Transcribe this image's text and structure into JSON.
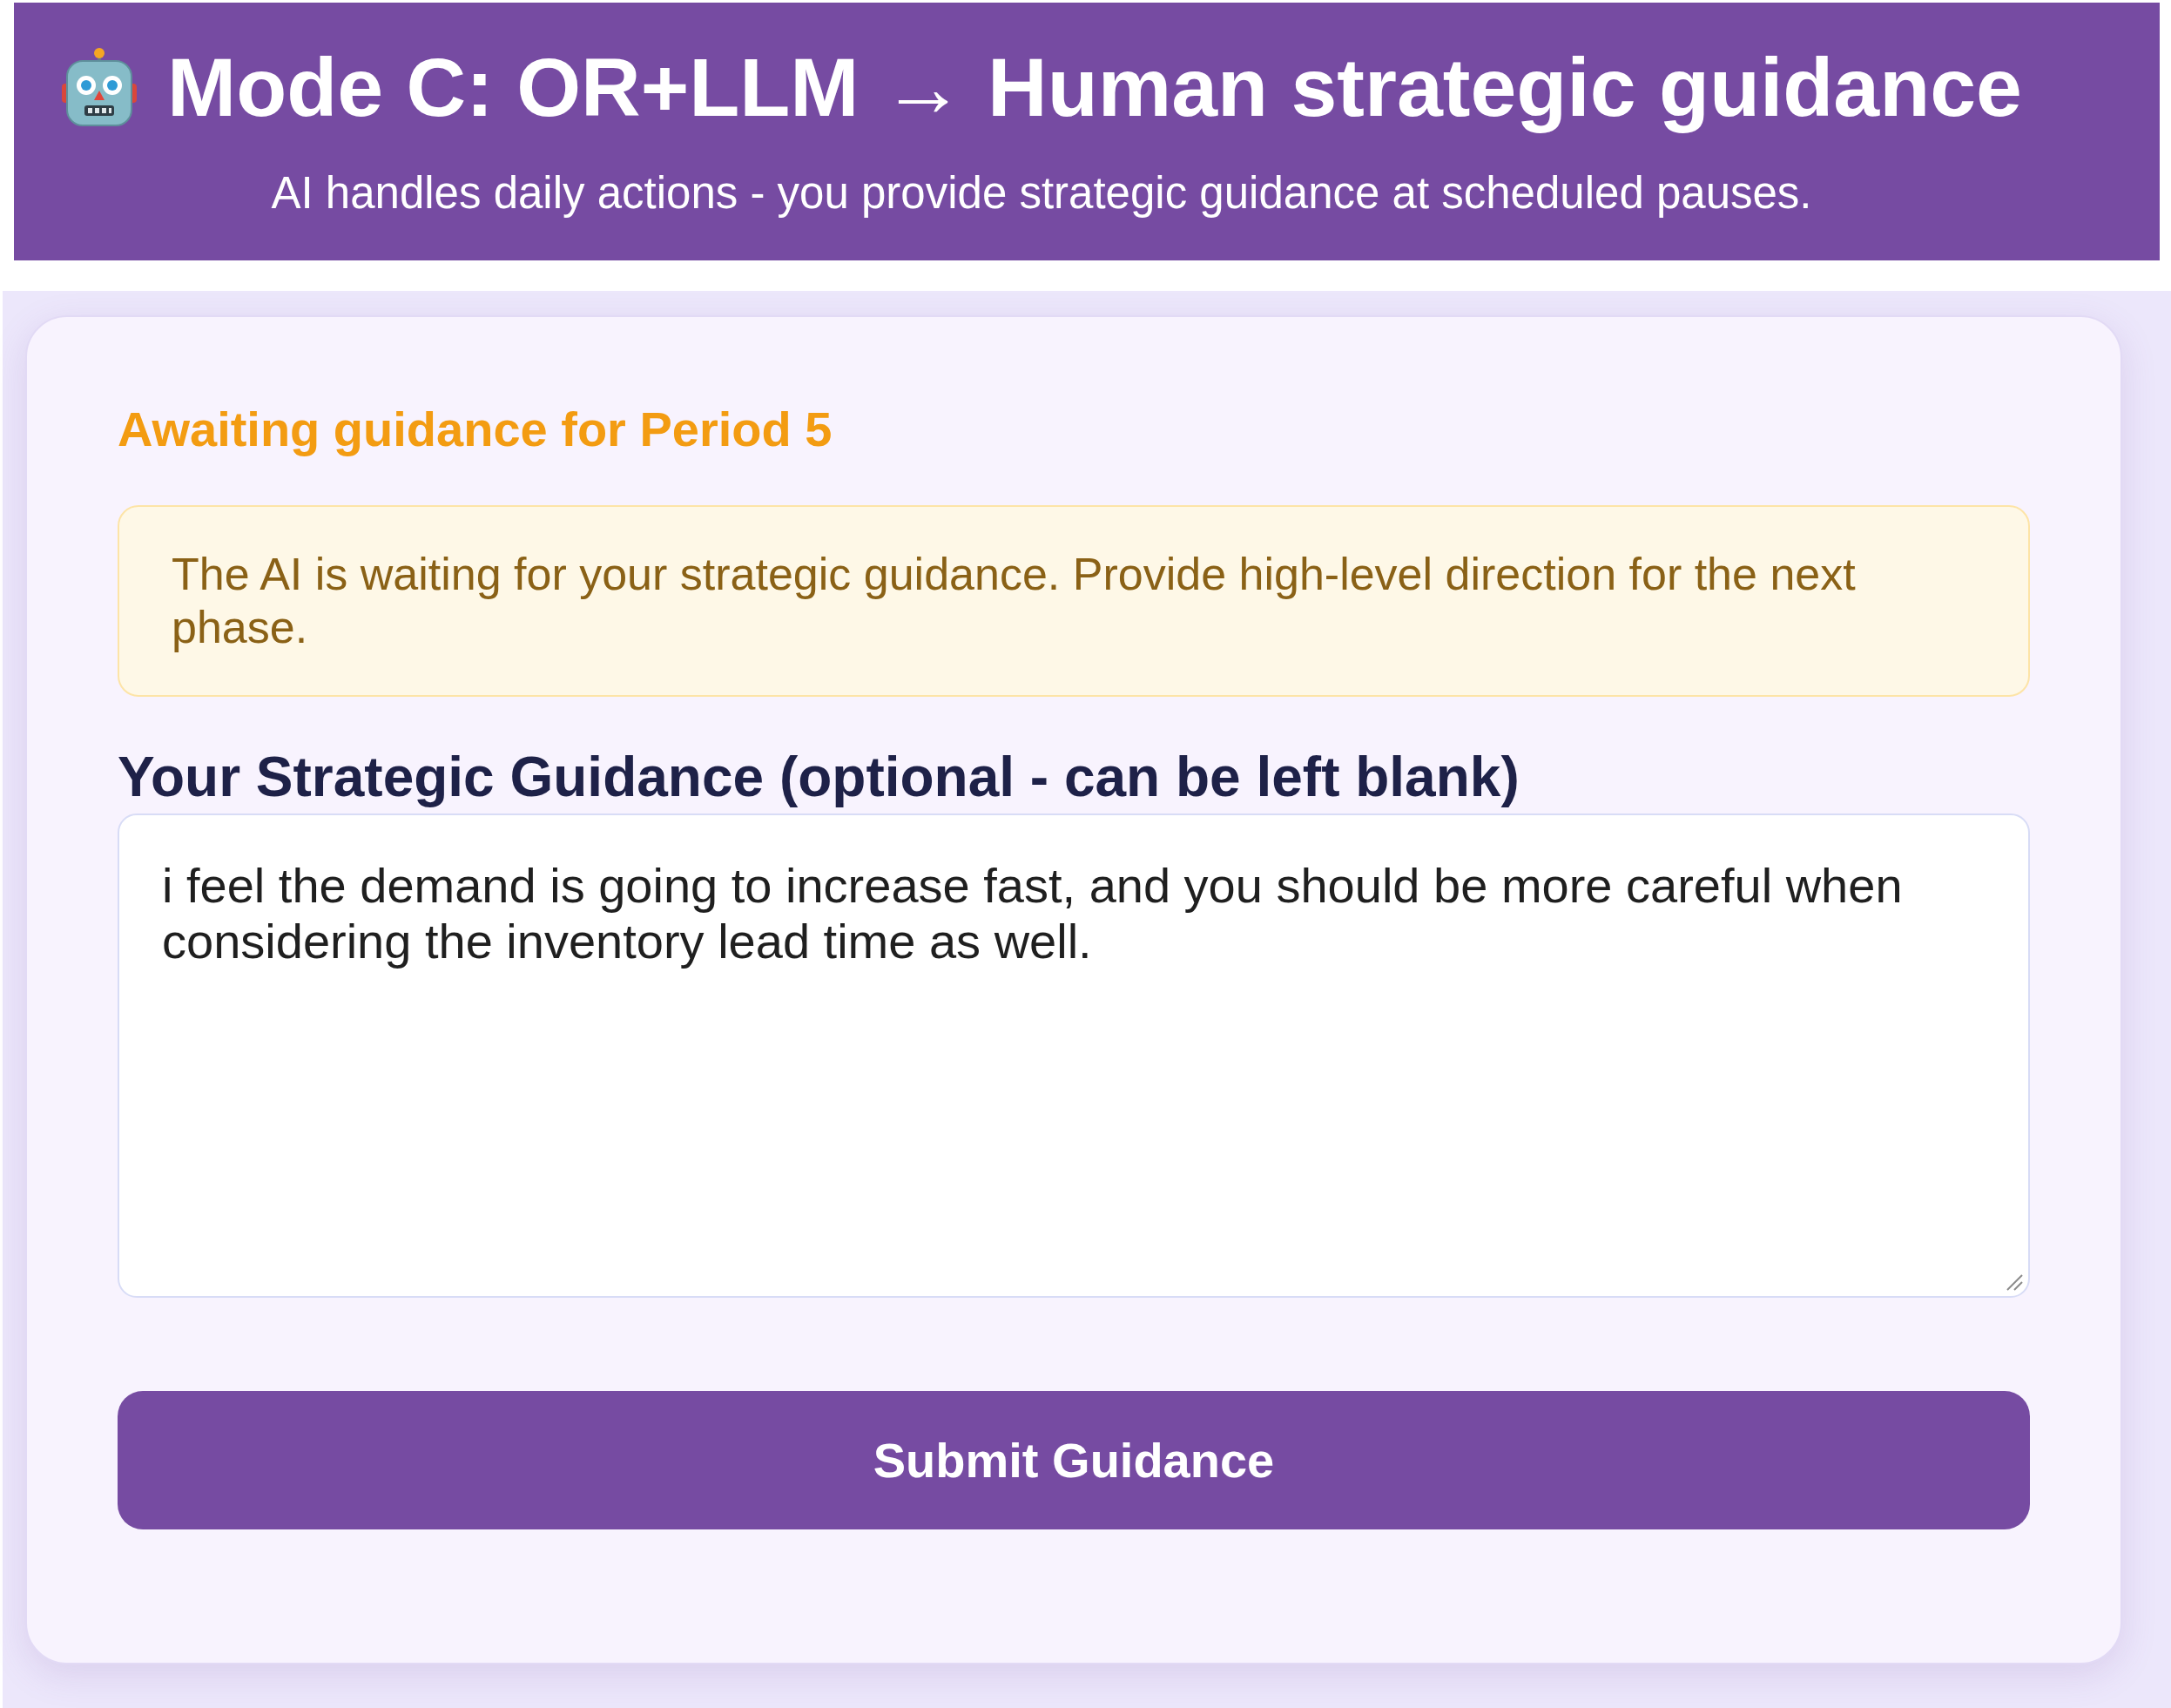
{
  "header": {
    "title": "Mode C: OR+LLM → Human strategic guidance",
    "subtitle": "AI handles daily actions - you provide strategic guidance at scheduled pauses."
  },
  "panel": {
    "status": "Awaiting guidance for Period 5",
    "notice": "The AI is waiting for your strategic guidance. Provide high-level direction for the next phase.",
    "guidance_field": {
      "label": "Your Strategic Guidance (optional - can be left blank)",
      "value": "i feel the demand is going to increase fast, and you should be more careful when considering the inventory lead time as well."
    },
    "submit_button": "Submit Guidance"
  }
}
